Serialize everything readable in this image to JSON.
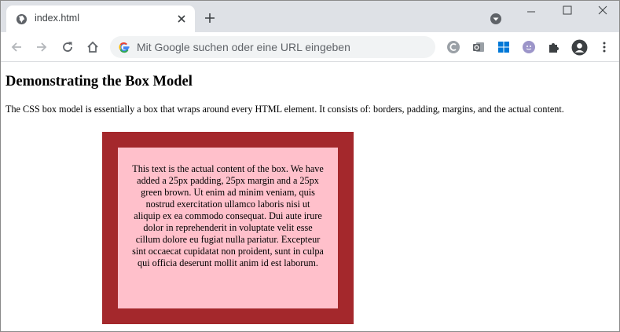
{
  "browser": {
    "tab": {
      "title": "index.html",
      "favicon": "globe-icon",
      "close_icon": "close-icon"
    },
    "new_tab_icon": "plus-icon",
    "profile_dropdown_icon": "chevron-down-circle-icon",
    "window_controls": [
      "minimize-icon",
      "maximize-icon",
      "close-icon"
    ],
    "nav": {
      "back_icon": "arrow-left-icon",
      "forward_icon": "arrow-right-icon",
      "reload_icon": "reload-icon",
      "home_icon": "home-icon"
    },
    "omnibox": {
      "placeholder": "Mit Google suchen oder eine URL eingeben",
      "icon": "google-g-icon"
    },
    "extensions": [
      "c-extension-icon",
      "outlook-icon",
      "windows-icon",
      "me-extension-icon",
      "puzzle-icon",
      "profile-avatar-icon",
      "more-vert-icon"
    ]
  },
  "page": {
    "heading": "Demonstrating the Box Model",
    "intro": "The CSS box model is essentially a box that wraps around every HTML element. It consists of: borders, padding, margins, and the actual content.",
    "box_text": "This text is the actual content of the box. We have added a 25px padding, 25px margin and a 25px green brown. Ut enim ad minim veniam, quis nostrud exercitation ullamco laboris nisi ut aliquip ex ea commodo consequat. Dui aute irure dolor in reprehenderit in voluptate velit esse cillum dolore eu fugiat nulla pariatur. Excepteur sint occaecat cupidatat non proident, sunt in culpa qui officia deserunt mollit anim id est laborum."
  },
  "colors": {
    "tabstrip": "#dee1e6",
    "box_border": "#a4282c",
    "box_background": "#ffc0cb"
  }
}
